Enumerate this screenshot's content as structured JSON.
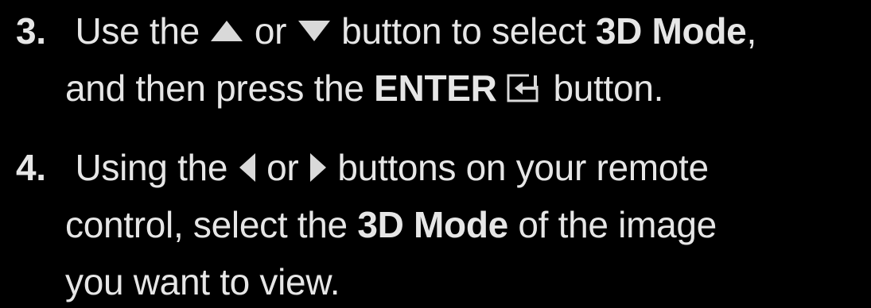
{
  "step3": {
    "number": "3.",
    "line1_a": "Use the",
    "up_icon": "up-arrow-icon",
    "line1_or": "or",
    "down_icon": "down-arrow-icon",
    "line1_b": "button to select",
    "line1_bold": "3D Mode",
    "line1_c": ",",
    "line2_a": "and then press the",
    "line2_bold": "ENTER",
    "enter_icon": "enter-key-icon",
    "line2_b": "button."
  },
  "step4": {
    "number": "4.",
    "line1_a": "Using the",
    "left_icon": "left-arrow-icon",
    "line1_or": "or",
    "right_icon": "right-arrow-icon",
    "line1_b": "buttons on your remote",
    "line2_a": "control, select the",
    "line2_bold": "3D Mode",
    "line2_b": "of the image",
    "line3": "you want to view."
  },
  "colors": {
    "background": "#000000",
    "text": "#e6e6e6"
  }
}
